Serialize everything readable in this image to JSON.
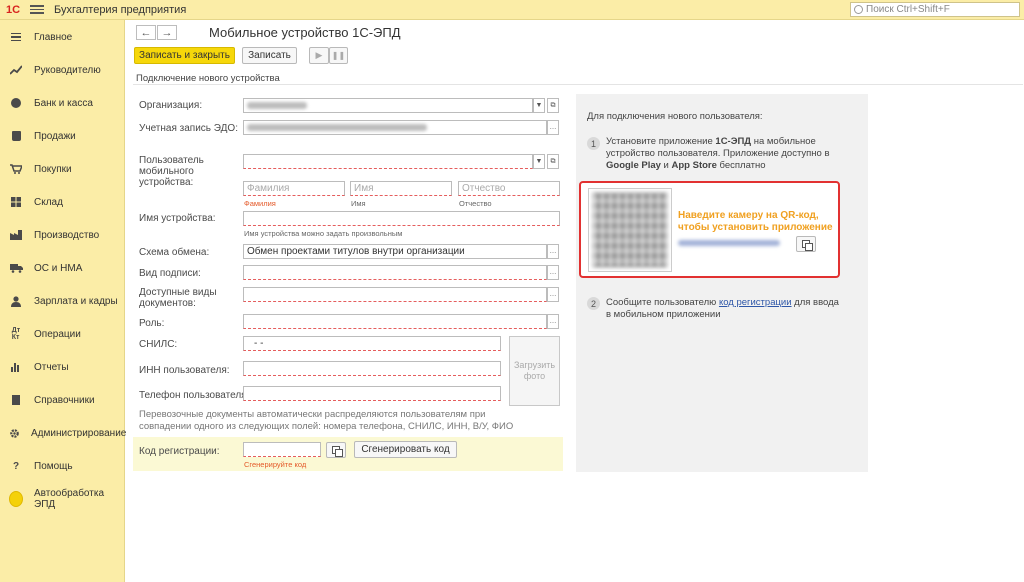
{
  "topbar": {
    "logo_text": "1С",
    "app_title": "Бухгалтерия предприятия",
    "search_placeholder": "Поиск Ctrl+Shift+F"
  },
  "sidebar": {
    "items": [
      {
        "label": "Главное",
        "icon": "menu-lines-icon"
      },
      {
        "label": "Руководителю",
        "icon": "trend-icon"
      },
      {
        "label": "Банк и касса",
        "icon": "coin-icon"
      },
      {
        "label": "Продажи",
        "icon": "bag-icon"
      },
      {
        "label": "Покупки",
        "icon": "cart-icon"
      },
      {
        "label": "Склад",
        "icon": "warehouse-icon"
      },
      {
        "label": "Производство",
        "icon": "factory-icon"
      },
      {
        "label": "ОС и НМА",
        "icon": "truck-icon"
      },
      {
        "label": "Зарплата и кадры",
        "icon": "person-icon"
      },
      {
        "label": "Операции",
        "icon": "operations-icon"
      },
      {
        "label": "Отчеты",
        "icon": "bar-chart-icon"
      },
      {
        "label": "Справочники",
        "icon": "books-icon"
      },
      {
        "label": "Администрирование",
        "icon": "gear-icon"
      },
      {
        "label": "Помощь",
        "icon": "question-icon"
      },
      {
        "label": "Автообработка ЭПД",
        "icon": "yellow-circle-icon"
      }
    ]
  },
  "toolbar": {
    "back": "←",
    "forward": "→",
    "title": "Мобильное устройство 1С-ЭПД",
    "save_close": "Записать и закрыть",
    "save": "Записать",
    "play": "▶",
    "pause": "❚❚"
  },
  "section_title": "Подключение нового устройства",
  "form": {
    "organization_label": "Организация:",
    "edo_label": "Учетная запись ЭДО:",
    "user_label": "Пользователь мобильного устройства:",
    "lastname_placeholder": "Фамилия",
    "firstname_placeholder": "Имя",
    "patronymic_placeholder": "Отчество",
    "lastname_hint": "Фамилия",
    "firstname_hint": "Имя",
    "patronymic_hint": "Отчество",
    "device_name_label": "Имя устройства:",
    "device_name_hint": "Имя устройства можно задать произвольным",
    "exchange_label": "Схема обмена:",
    "exchange_value": "Обмен проектами титулов внутри организации",
    "signature_label": "Вид подписи:",
    "doc_types_label": "Доступные виды документов:",
    "role_label": "Роль:",
    "snils_label": "СНИЛС:",
    "snils_value": "-   -",
    "inn_label": "ИНН пользователя:",
    "phone_label": "Телефон пользователя:",
    "photo_button": "Загрузить фото",
    "note": "Перевозочные документы автоматически распределяются пользователям при совпадении одного из следующих полей: номера телефона, СНИЛС, ИНН, В/У, ФИО",
    "reg_code_label": "Код регистрации:",
    "reg_code_hint": "Сгенерируйте код",
    "generate_button": "Сгенерировать код"
  },
  "right_panel": {
    "intro": "Для подключения нового пользователя:",
    "step1_num": "1",
    "step1_a": "Установите приложение ",
    "step1_b": "1С-ЭПД",
    "step1_c": " на мобильное устройство пользователя. Приложение доступно в ",
    "step1_d": "Google Play",
    "step1_e": " и ",
    "step1_f": "App Store",
    "step1_g": " бесплатно",
    "qr_instruction": "Наведите камеру на QR-код, чтобы установить приложение",
    "step2_num": "2",
    "step2_a": "Сообщите пользователю ",
    "step2_link": "код регистрации",
    "step2_b": " для ввода в мобильном приложении"
  },
  "colors": {
    "accent_yellow": "#f6d70a",
    "sidebar_bg": "#fbeda7",
    "qr_frame_red": "#e23131",
    "qr_text_orange": "#f0a020"
  }
}
